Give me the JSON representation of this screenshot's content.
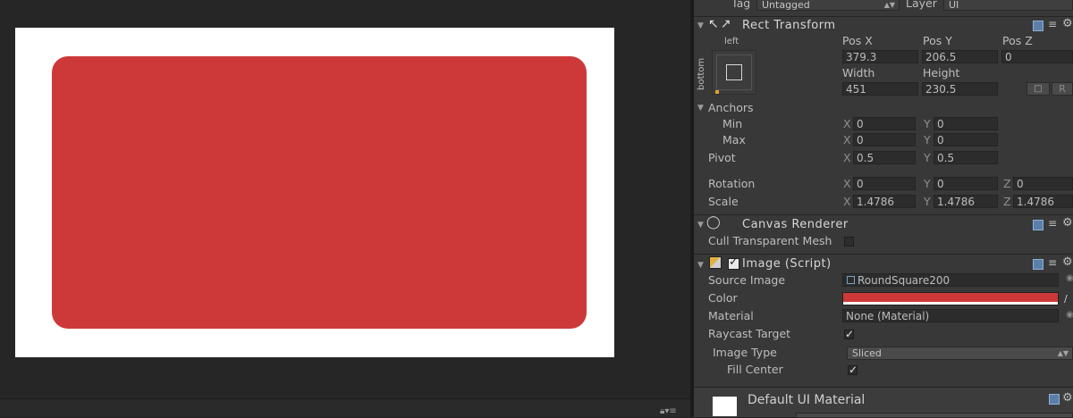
{
  "header": {
    "tag_label": "Tag",
    "tag_value": "Untagged",
    "layer_label": "Layer",
    "layer_value": "UI"
  },
  "rect_transform": {
    "title": "Rect Transform",
    "anchor_preset_h": "left",
    "anchor_preset_v": "bottom",
    "pos_x_label": "Pos X",
    "pos_y_label": "Pos Y",
    "pos_z_label": "Pos Z",
    "pos_x": "379.3",
    "pos_y": "206.5",
    "pos_z": "0",
    "width_label": "Width",
    "height_label": "Height",
    "width": "451",
    "height": "230.5",
    "raw_edit_label": "R",
    "anchors_label": "Anchors",
    "min_label": "Min",
    "max_label": "Max",
    "pivot_label": "Pivot",
    "rotation_label": "Rotation",
    "scale_label": "Scale",
    "x": "X",
    "y": "Y",
    "z": "Z",
    "anchor_min_x": "0",
    "anchor_min_y": "0",
    "anchor_max_x": "0",
    "anchor_max_y": "0",
    "pivot_x": "0.5",
    "pivot_y": "0.5",
    "rotation_x": "0",
    "rotation_y": "0",
    "rotation_z": "0",
    "scale_x": "1.4786",
    "scale_y": "1.4786",
    "scale_z": "1.4786"
  },
  "canvas_renderer": {
    "title": "Canvas Renderer",
    "cull_label": "Cull Transparent Mesh",
    "cull_checked": false
  },
  "image_script": {
    "title": "Image (Script)",
    "enabled": true,
    "source_image_label": "Source Image",
    "source_image_value": "RoundSquare200",
    "color_label": "Color",
    "color_value": "#cd3939",
    "material_label": "Material",
    "material_value": "None (Material)",
    "raycast_label": "Raycast Target",
    "raycast_checked": true,
    "image_type_label": "Image Type",
    "image_type_value": "Sliced",
    "fill_center_label": "Fill Center",
    "fill_center_checked": true
  },
  "material_footer": {
    "title": "Default UI Material"
  },
  "colors": {
    "image_red": "#cd3939",
    "inspector_bg": "#383838",
    "scene_bg": "#262626",
    "canvas_white": "#ffffff"
  }
}
